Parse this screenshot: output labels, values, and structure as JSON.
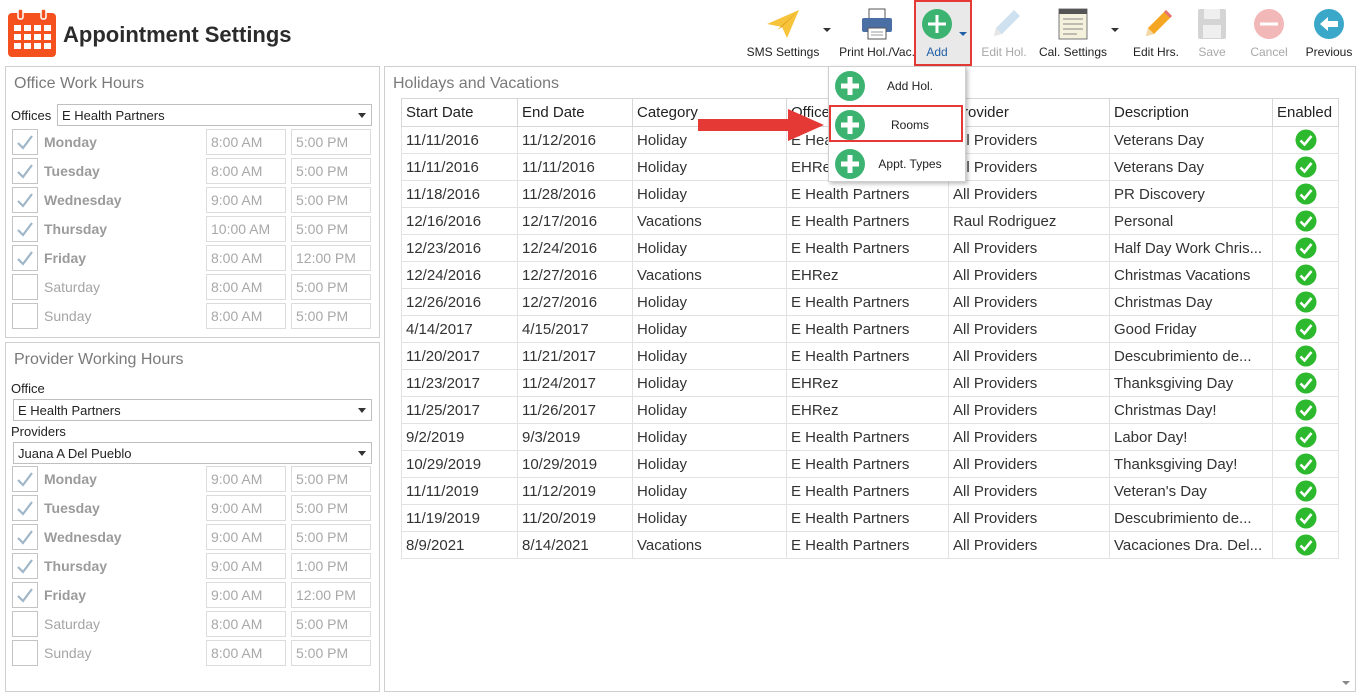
{
  "app": {
    "title": "Appointment Settings"
  },
  "toolbar": {
    "sms_settings": "SMS Settings",
    "print_hol_vac": "Print Hol./Vac.",
    "add": "Add",
    "edit_hol": "Edit Hol.",
    "cal_settings": "Cal. Settings",
    "edit_hrs": "Edit Hrs.",
    "save": "Save",
    "cancel": "Cancel",
    "previous": "Previous"
  },
  "add_menu": {
    "items": [
      {
        "label": "Add Hol."
      },
      {
        "label": "Rooms"
      },
      {
        "label": "Appt. Types"
      }
    ]
  },
  "office_hours": {
    "title": "Office Work Hours",
    "offices_label": "Offices",
    "office_selected": "E Health Partners",
    "days": [
      {
        "day": "Monday",
        "checked": true,
        "start": "8:00 AM",
        "end": "5:00 PM"
      },
      {
        "day": "Tuesday",
        "checked": true,
        "start": "8:00 AM",
        "end": "5:00 PM"
      },
      {
        "day": "Wednesday",
        "checked": true,
        "start": "9:00 AM",
        "end": "5:00 PM"
      },
      {
        "day": "Thursday",
        "checked": true,
        "start": "10:00 AM",
        "end": "5:00 PM"
      },
      {
        "day": "Friday",
        "checked": true,
        "start": "8:00 AM",
        "end": "12:00 PM"
      },
      {
        "day": "Saturday",
        "checked": false,
        "start": "8:00 AM",
        "end": "5:00 PM"
      },
      {
        "day": "Sunday",
        "checked": false,
        "start": "8:00 AM",
        "end": "5:00 PM"
      }
    ]
  },
  "provider_hours": {
    "title": "Provider Working Hours",
    "office_label": "Office",
    "office_selected": "E Health Partners",
    "providers_label": "Providers",
    "provider_selected": "Juana A Del Pueblo",
    "days": [
      {
        "day": "Monday",
        "checked": true,
        "start": "9:00 AM",
        "end": "5:00 PM"
      },
      {
        "day": "Tuesday",
        "checked": true,
        "start": "9:00 AM",
        "end": "5:00 PM"
      },
      {
        "day": "Wednesday",
        "checked": true,
        "start": "9:00 AM",
        "end": "5:00 PM"
      },
      {
        "day": "Thursday",
        "checked": true,
        "start": "9:00 AM",
        "end": "1:00 PM"
      },
      {
        "day": "Friday",
        "checked": true,
        "start": "9:00 AM",
        "end": "12:00 PM"
      },
      {
        "day": "Saturday",
        "checked": false,
        "start": "8:00 AM",
        "end": "5:00 PM"
      },
      {
        "day": "Sunday",
        "checked": false,
        "start": "8:00 AM",
        "end": "5:00 PM"
      }
    ]
  },
  "holidays": {
    "title": "Holidays and Vacations",
    "columns": [
      "Start Date",
      "End Date",
      "Category",
      "Office",
      "Provider",
      "Description",
      "Enabled"
    ],
    "rows": [
      {
        "start": "11/11/2016",
        "end": "11/12/2016",
        "category": "Holiday",
        "office": "E Health Partners",
        "provider": "All Providers",
        "description": "Veterans Day",
        "enabled": true
      },
      {
        "start": "11/11/2016",
        "end": "11/11/2016",
        "category": "Holiday",
        "office": "EHRez",
        "provider": "All Providers",
        "description": "Veterans Day",
        "enabled": true
      },
      {
        "start": "11/18/2016",
        "end": "11/28/2016",
        "category": "Holiday",
        "office": "E Health Partners",
        "provider": "All Providers",
        "description": "PR Discovery",
        "enabled": true
      },
      {
        "start": "12/16/2016",
        "end": "12/17/2016",
        "category": "Vacations",
        "office": "E Health Partners",
        "provider": "Raul Rodriguez",
        "description": "Personal",
        "enabled": true
      },
      {
        "start": "12/23/2016",
        "end": "12/24/2016",
        "category": "Holiday",
        "office": "E Health Partners",
        "provider": "All Providers",
        "description": "Half Day Work Chris...",
        "enabled": true
      },
      {
        "start": "12/24/2016",
        "end": "12/27/2016",
        "category": "Vacations",
        "office": "EHRez",
        "provider": "All Providers",
        "description": "Christmas Vacations",
        "enabled": true
      },
      {
        "start": "12/26/2016",
        "end": "12/27/2016",
        "category": "Holiday",
        "office": "E Health Partners",
        "provider": "All Providers",
        "description": "Christmas Day",
        "enabled": true
      },
      {
        "start": "4/14/2017",
        "end": "4/15/2017",
        "category": "Holiday",
        "office": "E Health Partners",
        "provider": "All Providers",
        "description": "Good Friday",
        "enabled": true
      },
      {
        "start": "11/20/2017",
        "end": "11/21/2017",
        "category": "Holiday",
        "office": "E Health Partners",
        "provider": "All Providers",
        "description": "Descubrimiento de...",
        "enabled": true
      },
      {
        "start": "11/23/2017",
        "end": "11/24/2017",
        "category": "Holiday",
        "office": "EHRez",
        "provider": "All Providers",
        "description": "Thanksgiving Day",
        "enabled": true
      },
      {
        "start": "11/25/2017",
        "end": "11/26/2017",
        "category": "Holiday",
        "office": "EHRez",
        "provider": "All Providers",
        "description": "Christmas Day!",
        "enabled": true
      },
      {
        "start": "9/2/2019",
        "end": "9/3/2019",
        "category": "Holiday",
        "office": "E Health Partners",
        "provider": "All Providers",
        "description": "Labor Day!",
        "enabled": true
      },
      {
        "start": "10/29/2019",
        "end": "10/29/2019",
        "category": "Holiday",
        "office": "E Health Partners",
        "provider": "All Providers",
        "description": "Thanksgiving Day!",
        "enabled": true
      },
      {
        "start": "11/11/2019",
        "end": "11/12/2019",
        "category": "Holiday",
        "office": "E Health Partners",
        "provider": "All Providers",
        "description": "Veteran's Day",
        "enabled": true
      },
      {
        "start": "11/19/2019",
        "end": "11/20/2019",
        "category": "Holiday",
        "office": "E Health Partners",
        "provider": "All Providers",
        "description": "Descubrimiento de...",
        "enabled": true
      },
      {
        "start": "8/9/2021",
        "end": "8/14/2021",
        "category": "Vacations",
        "office": "E Health Partners",
        "provider": "All Providers",
        "description": "Vacaciones Dra. Del...",
        "enabled": true
      }
    ]
  },
  "colors": {
    "accent_red": "#e53935",
    "add_green": "#3cb371",
    "enabled_green": "#2db92d",
    "logo_orange": "#f4511e"
  }
}
